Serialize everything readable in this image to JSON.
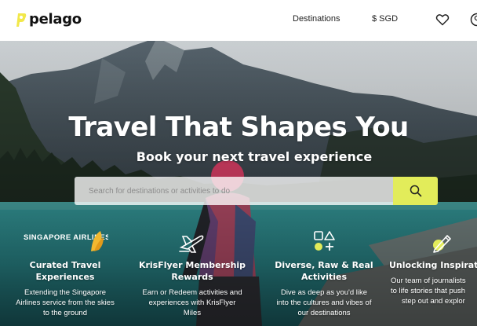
{
  "header": {
    "logo_text": "pelago",
    "nav": {
      "destinations": "Destinations",
      "currency": "$ SGD"
    },
    "icons": [
      "heart-icon",
      "profile-icon"
    ]
  },
  "hero": {
    "title": "Travel That Shapes You",
    "subtitle": "Book your next travel experience",
    "search": {
      "placeholder": "Search for destinations or activities to do",
      "button_icon": "search-icon"
    }
  },
  "features": [
    {
      "icon": "singapore-airlines-logo",
      "logo_text": "SINGAPORE AIRLINES",
      "title": "Curated Travel Experiences",
      "title_lines": [
        "Curated Travel",
        "Experiences"
      ],
      "description": "Extending the Singapore Airlines service from the skies to the ground",
      "description_lines": [
        "Extending the Singapore",
        "Airlines service from the skies",
        "to the ground"
      ]
    },
    {
      "icon": "plane-icon",
      "title": "KrisFlyer Membership Rewards",
      "title_lines": [
        "KrisFlyer Membership",
        "Rewards"
      ],
      "description": "Earn or Redeem activities and experiences with KrisFlyer Miles",
      "description_lines": [
        "Earn or Redeem activities and",
        "experiences with KrisFlyer",
        "Miles"
      ]
    },
    {
      "icon": "shapes-icon",
      "title": "Diverse, Raw & Real Activities",
      "title_lines": [
        "Diverse, Raw & Real",
        "Activities"
      ],
      "description": "Dive as deep as you'd like into the cultures and vibes of our destinations",
      "description_lines": [
        "Dive as deep as you'd like",
        "into the cultures and vibes of",
        "our destinations"
      ]
    },
    {
      "icon": "pen-icon",
      "title": "Unlocking Inspirat",
      "title_lines": [
        "Unlocking Inspirat"
      ],
      "description": "Our team of journalists to life stories that push step out and explor",
      "description_lines": [
        "Our team of journalists",
        "to life stories that push",
        "step out and explor"
      ]
    }
  ],
  "colors": {
    "accent": "#e2ec5a",
    "logo_yellow": "#f2e84a"
  }
}
